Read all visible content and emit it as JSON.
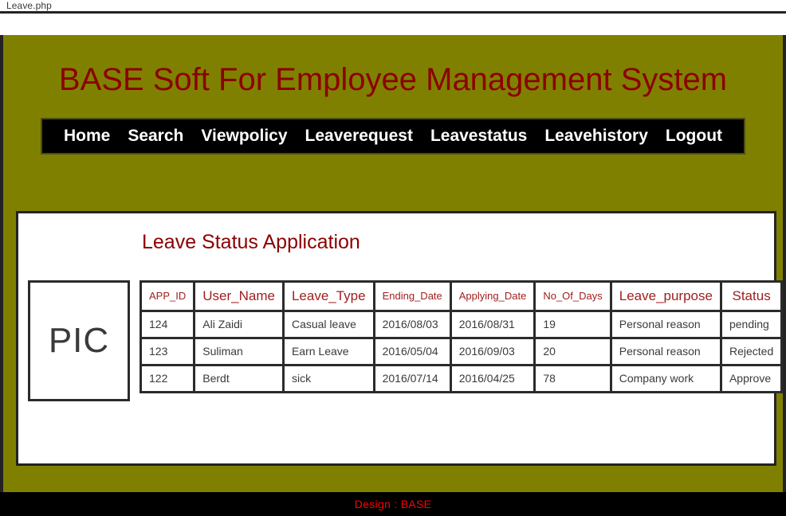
{
  "window": {
    "tab_label": "Leave.php"
  },
  "header": {
    "site_title": "BASE Soft For Employee Management System"
  },
  "nav": {
    "items": [
      {
        "label": "Home"
      },
      {
        "label": "Search"
      },
      {
        "label": "Viewpolicy"
      },
      {
        "label": "Leaverequest"
      },
      {
        "label": "Leavestatus"
      },
      {
        "label": "Leavehistory"
      },
      {
        "label": "Logout"
      }
    ]
  },
  "main": {
    "panel_title": "Leave Status Application",
    "pic_placeholder": "PIC",
    "table": {
      "columns": [
        {
          "key": "app_id",
          "label": "APP_ID",
          "size": "small"
        },
        {
          "key": "user_name",
          "label": "User_Name",
          "size": "big"
        },
        {
          "key": "leave_type",
          "label": "Leave_Type",
          "size": "big"
        },
        {
          "key": "ending_date",
          "label": "Ending_Date",
          "size": "small"
        },
        {
          "key": "applying_date",
          "label": "Applying_Date",
          "size": "small"
        },
        {
          "key": "no_of_days",
          "label": "No_Of_Days",
          "size": "small"
        },
        {
          "key": "leave_purpose",
          "label": "Leave_purpose",
          "size": "big"
        },
        {
          "key": "status",
          "label": "Status",
          "size": "big"
        }
      ],
      "rows": [
        {
          "app_id": "124",
          "user_name": "Ali Zaidi",
          "leave_type": "Casual leave",
          "ending_date": "2016/08/03",
          "applying_date": "2016/08/31",
          "no_of_days": "19",
          "leave_purpose": "Personal reason",
          "status": "pending"
        },
        {
          "app_id": "123",
          "user_name": "Suliman",
          "leave_type": "Earn Leave",
          "ending_date": "2016/05/04",
          "applying_date": "2016/09/03",
          "no_of_days": "20",
          "leave_purpose": "Personal reason",
          "status": "Rejected"
        },
        {
          "app_id": "122",
          "user_name": "Berdt",
          "leave_type": "sick",
          "ending_date": "2016/07/14",
          "applying_date": "2016/04/25",
          "no_of_days": "78",
          "leave_purpose": "Company work",
          "status": "Approve"
        }
      ]
    }
  },
  "footer": {
    "text": "Design :  BASE"
  },
  "colors": {
    "page_background": "#808000",
    "title_text": "#8b0000",
    "nav_background": "#000000",
    "nav_text": "#ffffff",
    "table_header_text": "#a02020",
    "footer_text": "#ff0000",
    "border": "#232323"
  }
}
